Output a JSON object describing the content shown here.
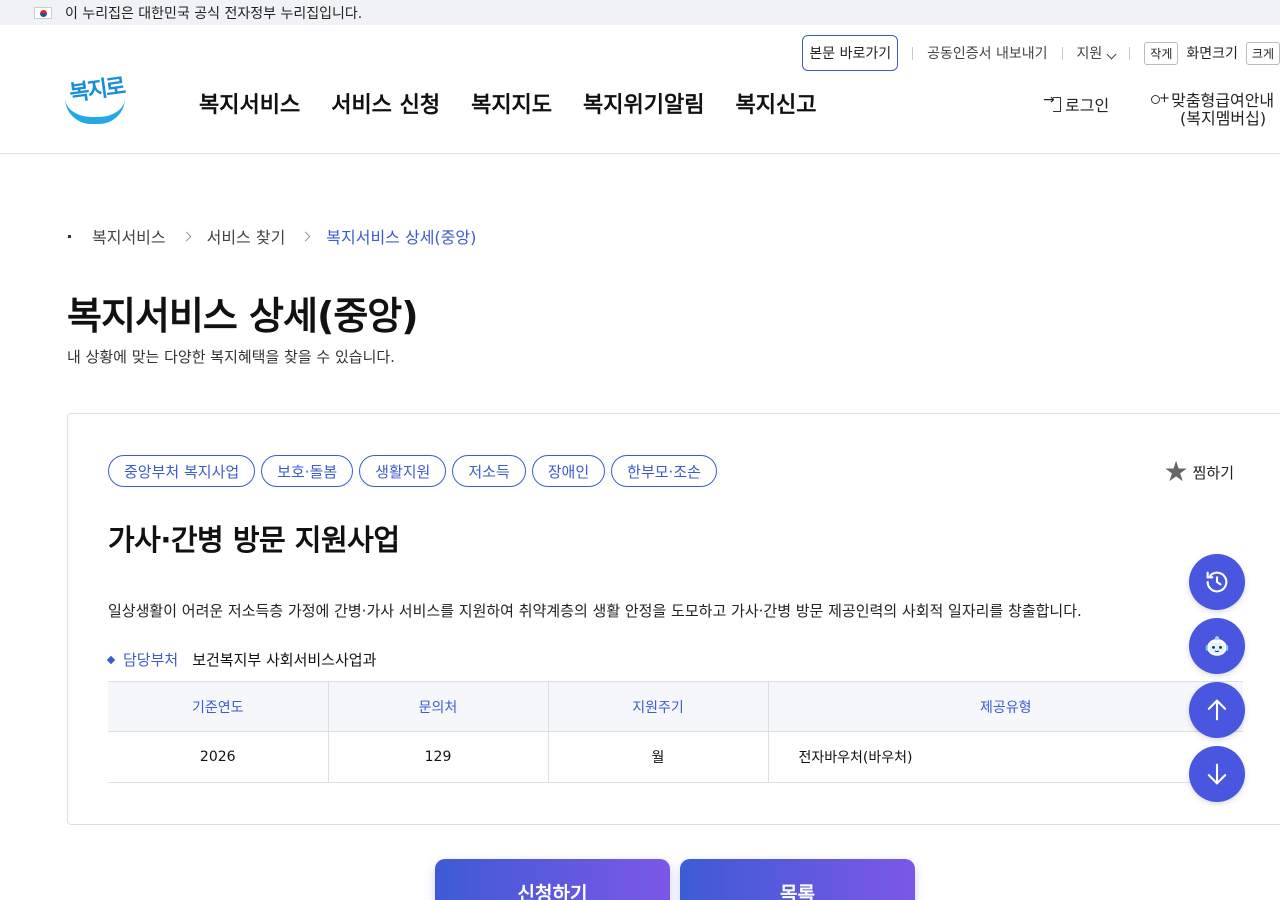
{
  "gov_banner": {
    "text": "이 누리집은 대한민국 공식 전자정부 누리집입니다."
  },
  "header": {
    "logo_text": "복지로",
    "util": {
      "skip_label": "본문 바로가기",
      "cert_label": "공동인증서 내보내기",
      "support_label": "지원",
      "font_small": "작게",
      "font_size_label": "화면크기",
      "font_large": "크게"
    },
    "gnb": [
      "복지서비스",
      "서비스 신청",
      "복지지도",
      "복지위기알림",
      "복지신고"
    ],
    "login_label": "로그인",
    "member_line1": "맞춤형급여안내",
    "member_line2": "(복지멤버십)"
  },
  "breadcrumb": [
    "복지서비스",
    "서비스 찾기",
    "복지서비스 상세(중앙)"
  ],
  "page": {
    "title": "복지서비스 상세(중앙)",
    "subtitle": "내 상황에 맞는 다양한 복지혜택을 찾을 수 있습니다."
  },
  "service": {
    "tags": [
      "중앙부처 복지사업",
      "보호·돌봄",
      "생활지원",
      "저소득",
      "장애인",
      "한부모·조손"
    ],
    "favorite_label": "찜하기",
    "title": "가사·간병 방문 지원사업",
    "description": "일상생활이 어려운 저소득층 가정에 간병·가사 서비스를 지원하여 취약계층의 생활 안정을 도모하고 가사·간병 방문 제공인력의 사회적 일자리를 창출합니다.",
    "dept_label": "담당부처",
    "dept_value": "보건복지부 사회서비스사업과",
    "table": {
      "headers": [
        "기준연도",
        "문의처",
        "지원주기",
        "제공유형"
      ],
      "row": [
        "2026",
        "129",
        "월",
        "전자바우처(바우처)"
      ]
    }
  },
  "actions": {
    "apply_label": "신청하기",
    "list_label": "목록"
  },
  "colors": {
    "accent": "#3d5bd0",
    "float": "#4856e0"
  },
  "float_icons": [
    "history-icon",
    "chatbot-icon",
    "arrow-up-icon",
    "arrow-down-icon"
  ]
}
